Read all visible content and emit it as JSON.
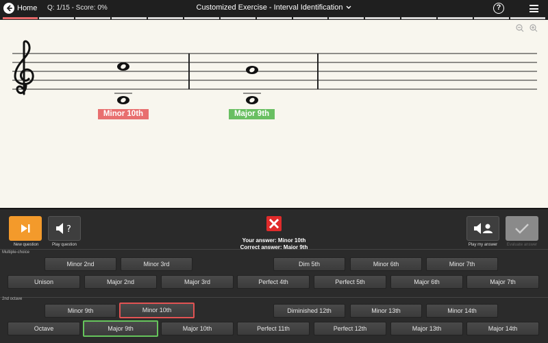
{
  "header": {
    "home_label": "Home",
    "status": "Q: 1/15 - Score: 0%",
    "title": "Customized Exercise - Interval Identification"
  },
  "progress": {
    "total": 15,
    "current": 1
  },
  "staff": {
    "badges": [
      {
        "text": "Minor 10th",
        "color": "#e86f6f"
      },
      {
        "text": "Major 9th",
        "color": "#69bf62"
      }
    ]
  },
  "controls": {
    "new_question": "New question",
    "play_question": "Play question",
    "play_my_answer": "Play my answer",
    "evaluate_answer": "Evaluate answer",
    "your_answer": "Your answer: Minor 10th",
    "correct_answer": "Correct answer: Major 9th"
  },
  "answers": {
    "section1_label": "Multiple-choice",
    "section2_label": "2nd octave",
    "row1": [
      "Minor 2nd",
      "Minor 3rd",
      "Dim 5th",
      "Minor 6th",
      "Minor 7th"
    ],
    "row2": [
      "Unison",
      "Major 2nd",
      "Major 3rd",
      "Perfect 4th",
      "Perfect 5th",
      "Major 6th",
      "Major 7th"
    ],
    "row3": [
      "Minor 9th",
      "Minor 10th",
      "Diminished 12th",
      "Minor 13th",
      "Minor 14th"
    ],
    "row4": [
      "Octave",
      "Major 9th",
      "Major 10th",
      "Perfect 11th",
      "Perfect 12th",
      "Major 13th",
      "Major 14th"
    ]
  },
  "colors": {
    "accent": "#f39a2b",
    "wrong": "#e35353",
    "correct": "#66c55c"
  }
}
